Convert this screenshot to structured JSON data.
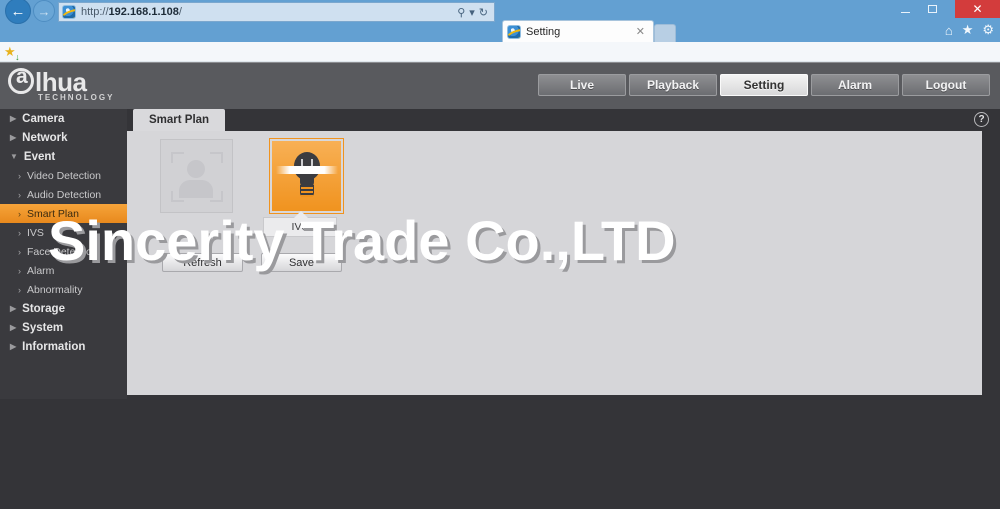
{
  "browser": {
    "window_controls": {
      "minimize": "–",
      "maximize": "❐",
      "close": "✕"
    },
    "back_glyph": "←",
    "forward_glyph": "→",
    "url_prefix": "http://",
    "url_host": "192.168.1.108",
    "url_suffix": "/",
    "search_icon": "⚲",
    "dropdown_icon": "▾",
    "refresh_icon": "↻",
    "tab_title": "Setting",
    "tab_close": "✕",
    "tools": {
      "home": "⌂",
      "favorites": "★",
      "settings": "⚙"
    },
    "favorites_star": "★"
  },
  "device_ui": {
    "logo": {
      "mark": "@",
      "word": "lhua",
      "subtitle": "TECHNOLOGY"
    },
    "topnav": [
      {
        "label": "Live",
        "active": false
      },
      {
        "label": "Playback",
        "active": false
      },
      {
        "label": "Setting",
        "active": true
      },
      {
        "label": "Alarm",
        "active": false
      },
      {
        "label": "Logout",
        "active": false
      }
    ],
    "sidebar": [
      {
        "label": "Camera",
        "level": "top",
        "caret": "▶",
        "selected": false
      },
      {
        "label": "Network",
        "level": "top",
        "caret": "▶",
        "selected": false
      },
      {
        "label": "Event",
        "level": "top",
        "caret": "▼",
        "selected": false
      },
      {
        "label": "Video Detection",
        "level": "sub",
        "caret": "›",
        "selected": false
      },
      {
        "label": "Audio Detection",
        "level": "sub",
        "caret": "›",
        "selected": false
      },
      {
        "label": "Smart Plan",
        "level": "sub",
        "caret": "›",
        "selected": true
      },
      {
        "label": "IVS",
        "level": "sub",
        "caret": "›",
        "selected": false
      },
      {
        "label": "Face Detection",
        "level": "sub",
        "caret": "›",
        "selected": false
      },
      {
        "label": "Alarm",
        "level": "sub",
        "caret": "›",
        "selected": false
      },
      {
        "label": "Abnormality",
        "level": "sub",
        "caret": "›",
        "selected": false
      },
      {
        "label": "Storage",
        "level": "top",
        "caret": "▶",
        "selected": false
      },
      {
        "label": "System",
        "level": "top",
        "caret": "▶",
        "selected": false
      },
      {
        "label": "Information",
        "level": "top",
        "caret": "▶",
        "selected": false
      }
    ],
    "content": {
      "tab_label": "Smart Plan",
      "help_glyph": "?",
      "tiles": [
        {
          "name": "face-detection",
          "label": "",
          "selected": false
        },
        {
          "name": "ivs",
          "label": "IVS",
          "selected": true
        }
      ],
      "selected_tile_label": "IVS",
      "buttons": {
        "refresh": "Refresh",
        "save": "Save"
      }
    },
    "accent_color": "#f0931f",
    "header_color": "#595a5e",
    "body_color": "#343438"
  },
  "watermark": {
    "text": "Sincerity Trade Co.,LTD"
  }
}
